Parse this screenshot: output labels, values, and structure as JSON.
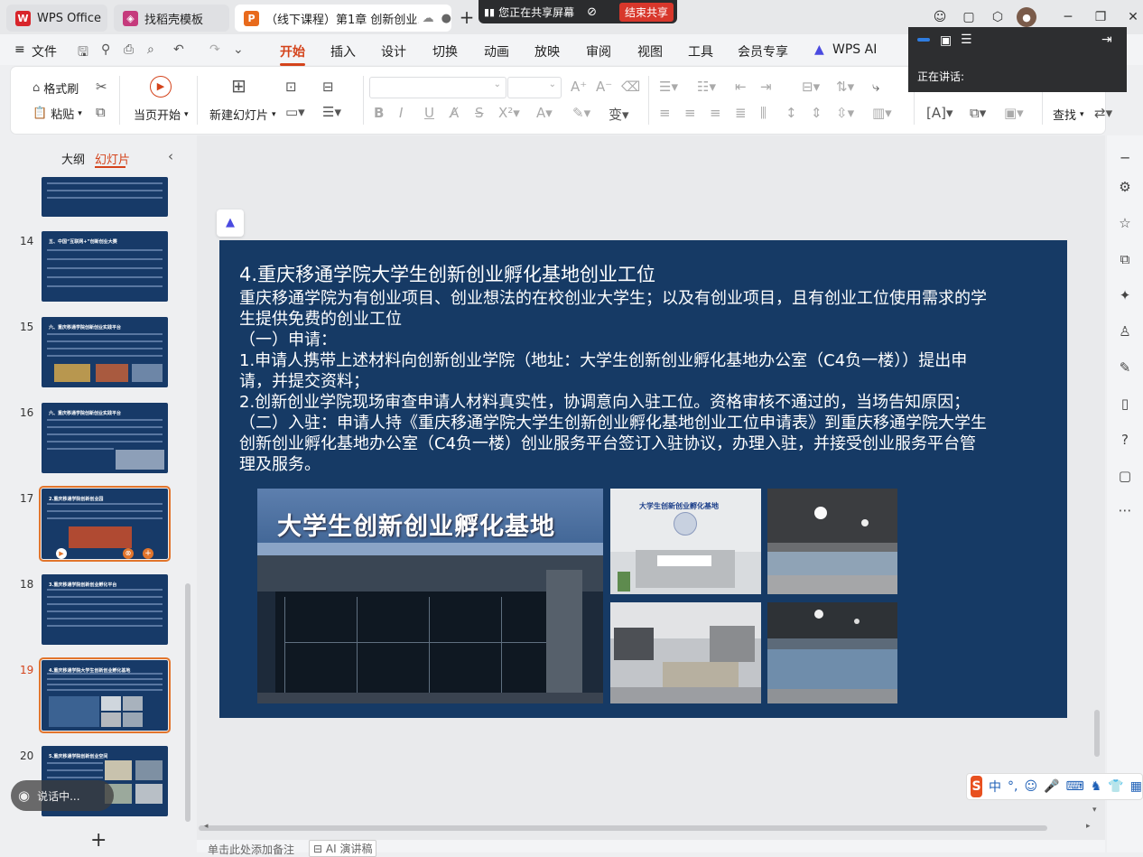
{
  "tabs": [
    {
      "label": "WPS Office",
      "icon": "wps-logo-icon"
    },
    {
      "label": "找稻壳模板",
      "icon": "docer-icon"
    },
    {
      "label": "（线下课程）第1章 创新创业…",
      "icon": "presentation-icon"
    }
  ],
  "share_bar": {
    "status": "您正在共享屏幕",
    "stop": "结束共享"
  },
  "menu": [
    "文件",
    "开始",
    "插入",
    "设计",
    "切换",
    "动画",
    "放映",
    "审阅",
    "视图",
    "工具",
    "会员专享",
    "WPS AI"
  ],
  "menu_active": "开始",
  "ribbon": {
    "format_painter": "格式刷",
    "paste": "粘贴",
    "play_current": "当页开始",
    "new_slide": "新建幻灯片",
    "find": "查找"
  },
  "speaking": {
    "label": "正在讲话:"
  },
  "left_panel": {
    "tab_outline": "大纲",
    "tab_slides": "幻灯片",
    "slides": [
      {
        "num": "14",
        "title": "五、中国“互联网+”创新创业大赛"
      },
      {
        "num": "15",
        "title": "六、重庆移通学院创新创业实践平台"
      },
      {
        "num": "16",
        "title": "六、重庆移通学院创新创业实践平台"
      },
      {
        "num": "17",
        "title": "2.重庆移通学院创新创业园"
      },
      {
        "num": "18",
        "title": "3.重庆移通学院创新创业孵化平台"
      },
      {
        "num": "19",
        "title": "4.重庆移通学院大学生创新创业孵化基地"
      },
      {
        "num": "20",
        "title": "5.重庆移通学院创新创业空间"
      }
    ],
    "float_label": "说话中...",
    "add": "+"
  },
  "slide": {
    "title": "4.重庆移通学院大学生创新创业孵化基地创业工位",
    "lines": [
      "重庆移通学院为有创业项目、创业想法的在校创业大学生；以及有创业项目，且有创业工位使用需求的学",
      "生提供免费的创业工位",
      "（一）申请：",
      "1.申请人携带上述材料向创新创业学院（地址：大学生创新创业孵化基地办公室（C4负一楼））提出申",
      "请，并提交资料；",
      "2.创新创业学院现场审查申请人材料真实性，协调意向入驻工位。资格审核不通过的，当场告知原因；",
      "（二）入驻：申请人持《重庆移通学院大学生创新创业孵化基地创业工位申请表》到重庆移通学院大学生",
      "创新创业孵化基地办公室（C4负一楼）创业服务平台签订入驻协议，办理入驻，并接受创业服务平台管",
      "理及服务。"
    ],
    "sign_text": "大学生创新创业孵化基地",
    "reception_sign": "大学生创新创业孵化基地"
  },
  "notes": {
    "placeholder": "单击此处添加备注",
    "ai_script": "AI 演讲稿"
  },
  "ime": {
    "lang": "中"
  }
}
